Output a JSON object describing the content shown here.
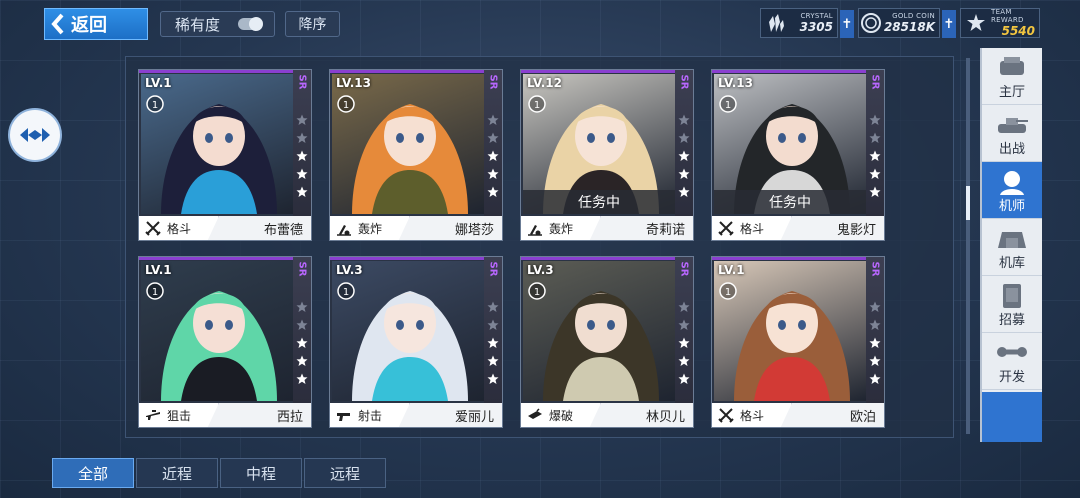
{
  "header": {
    "back_label": "返回",
    "sort_label": "稀有度",
    "order_label": "降序"
  },
  "resources": [
    {
      "name": "CRYSTAL",
      "value": "3305",
      "icon": "crystal-icon"
    },
    {
      "name": "GOLD COIN",
      "value": "28518K",
      "icon": "gold-coin-icon"
    },
    {
      "name": "TEAM REWARD",
      "value": "5540",
      "icon": "team-reward-icon"
    }
  ],
  "cards": [
    {
      "level": "LV.1",
      "rank": "1",
      "rarity": "SR",
      "class": "格斗",
      "class_icon": "crossed-swords-icon",
      "name": "布蕾德",
      "status": "",
      "hair": "#1d1f3a",
      "skin": "#f4dcd0",
      "bg": "#4a6a8c",
      "accent": "#2a9fd8"
    },
    {
      "level": "LV.13",
      "rank": "1",
      "rarity": "SR",
      "class": "轰炸",
      "class_icon": "mortar-icon",
      "name": "娜塔莎",
      "status": "",
      "hair": "#e68a3a",
      "skin": "#f6e0d2",
      "bg": "#7a6a4a",
      "accent": "#5d5e2c"
    },
    {
      "level": "LV.12",
      "rank": "1",
      "rarity": "SR",
      "class": "轰炸",
      "class_icon": "mortar-icon",
      "name": "奇莉诺",
      "status": "任务中",
      "hair": "#ead3a6",
      "skin": "#f6e3d6",
      "bg": "#c8c6c0",
      "accent": "#2a2426"
    },
    {
      "level": "LV.13",
      "rank": "1",
      "rarity": "SR",
      "class": "格斗",
      "class_icon": "crossed-swords-icon",
      "name": "鬼影灯",
      "status": "任务中",
      "hair": "#232629",
      "skin": "#f3dccf",
      "bg": "#bdbfc2",
      "accent": "#d7d7d7"
    },
    {
      "level": "LV.1",
      "rank": "1",
      "rarity": "SR",
      "class": "狙击",
      "class_icon": "sniper-rifle-icon",
      "name": "西拉",
      "status": "",
      "hair": "#5fd6a8",
      "skin": "#f5dfd5",
      "bg": "#2f3d4d",
      "accent": "#1a1c24"
    },
    {
      "level": "LV.3",
      "rank": "1",
      "rarity": "SR",
      "class": "射击",
      "class_icon": "gun-icon",
      "name": "爱丽儿",
      "status": "",
      "hair": "#dfe6f0",
      "skin": "#f6e6de",
      "bg": "#3c4a63",
      "accent": "#37c0d8"
    },
    {
      "level": "LV.3",
      "rank": "1",
      "rarity": "SR",
      "class": "爆破",
      "class_icon": "explosive-icon",
      "name": "林贝儿",
      "status": "",
      "hair": "#3c3628",
      "skin": "#f0ddd0",
      "bg": "#5c5d55",
      "accent": "#cfcab0"
    },
    {
      "level": "LV.1",
      "rank": "1",
      "rarity": "SR",
      "class": "格斗",
      "class_icon": "crossed-swords-icon",
      "name": "欧泊",
      "status": "",
      "hair": "#9a5e3a",
      "skin": "#f7e2d4",
      "bg": "#d8c8b8",
      "accent": "#d23a35"
    }
  ],
  "nav": [
    {
      "label": "主厅",
      "icon": "main-hall-icon",
      "active": false
    },
    {
      "label": "出战",
      "icon": "deploy-tank-icon",
      "active": false
    },
    {
      "label": "机师",
      "icon": "pilot-icon",
      "active": true
    },
    {
      "label": "机库",
      "icon": "hangar-icon",
      "active": false
    },
    {
      "label": "招募",
      "icon": "recruit-icon",
      "active": false
    },
    {
      "label": "开发",
      "icon": "develop-wrench-icon",
      "active": false
    }
  ],
  "filters": [
    {
      "label": "全部",
      "active": true
    },
    {
      "label": "近程",
      "active": false
    },
    {
      "label": "中程",
      "active": false
    },
    {
      "label": "远程",
      "active": false
    }
  ],
  "colors": {
    "accent": "#2f74d0",
    "rarity_sr": "#b967ff",
    "gold": "#f3c640"
  }
}
